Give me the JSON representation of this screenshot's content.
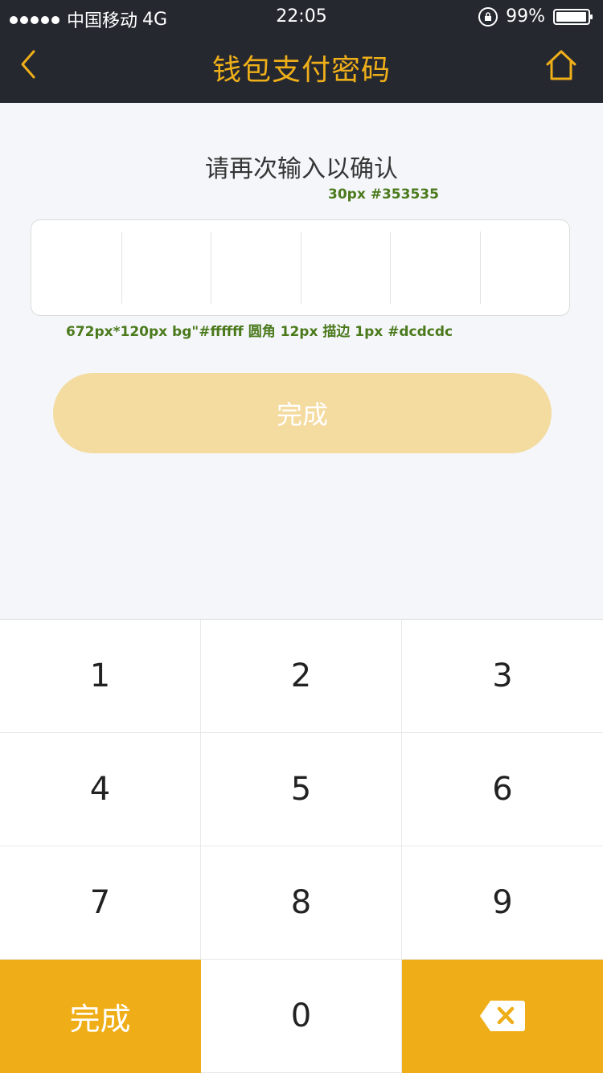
{
  "status_bar": {
    "carrier": "中国移动",
    "network": "4G",
    "time": "22:05",
    "battery": "99%",
    "battery_level": 0.99
  },
  "nav": {
    "title": "钱包支付密码",
    "back_icon": "chevron-left-icon",
    "home_icon": "home-icon",
    "accent_color": "#efaf19"
  },
  "prompt": {
    "text": "请再次输入以确认",
    "note": "30px  #353535"
  },
  "password": {
    "cells": [
      "",
      "",
      "",
      "",
      "",
      ""
    ],
    "note": "672px*120px bg\"#ffffff  圆角 12px  描边 1px  #dcdcdc"
  },
  "done_button": {
    "label": "完成"
  },
  "keypad": {
    "keys": [
      "1",
      "2",
      "3",
      "4",
      "5",
      "6",
      "7",
      "8",
      "9"
    ],
    "done_label": "完成",
    "zero": "0",
    "delete_icon": "backspace-icon"
  }
}
